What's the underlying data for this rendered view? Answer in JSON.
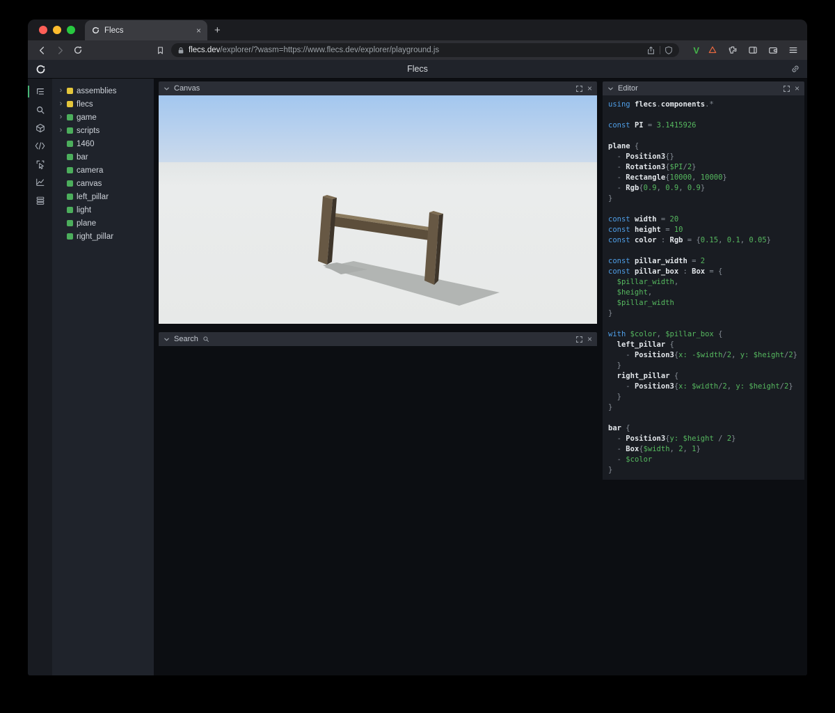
{
  "glyphs": {
    "close": "×",
    "plus": "+",
    "chevron": "›"
  },
  "browser": {
    "tab_title": "Flecs",
    "url_domain": "flecs.dev",
    "url_path": "/explorer/?wasm=https://www.flecs.dev/explorer/playground.js",
    "ext_v_label": "V",
    "traffic": {
      "red": "#ff5f57",
      "yellow": "#febc2e",
      "green": "#28c840"
    }
  },
  "app": {
    "title": "Flecs"
  },
  "tree": {
    "type_colors": {
      "module": "#e4c63b",
      "entity": "#4cae5c"
    },
    "items": [
      {
        "label": "assemblies",
        "type": "module",
        "expandable": true
      },
      {
        "label": "flecs",
        "type": "module",
        "expandable": true
      },
      {
        "label": "game",
        "type": "entity",
        "expandable": true
      },
      {
        "label": "scripts",
        "type": "entity",
        "expandable": true
      },
      {
        "label": "1460",
        "type": "entity",
        "expandable": false
      },
      {
        "label": "bar",
        "type": "entity",
        "expandable": false
      },
      {
        "label": "camera",
        "type": "entity",
        "expandable": false
      },
      {
        "label": "canvas",
        "type": "entity",
        "expandable": false
      },
      {
        "label": "left_pillar",
        "type": "entity",
        "expandable": false
      },
      {
        "label": "light",
        "type": "entity",
        "expandable": false
      },
      {
        "label": "plane",
        "type": "entity",
        "expandable": false
      },
      {
        "label": "right_pillar",
        "type": "entity",
        "expandable": false
      }
    ]
  },
  "canvas_panel": {
    "title": "Canvas"
  },
  "search_panel": {
    "title": "Search"
  },
  "editor_panel": {
    "title": "Editor",
    "lines": [
      [
        [
          "k",
          "using"
        ],
        [
          "t",
          " "
        ],
        [
          "i",
          "flecs"
        ],
        [
          "p",
          "."
        ],
        [
          "i",
          "components"
        ],
        [
          "p",
          ".*"
        ]
      ],
      [],
      [
        [
          "k",
          "const"
        ],
        [
          "t",
          " "
        ],
        [
          "i",
          "PI"
        ],
        [
          "p",
          " = "
        ],
        [
          "n",
          "3.1415926"
        ]
      ],
      [],
      [
        [
          "i",
          "plane"
        ],
        [
          "p",
          " {"
        ]
      ],
      [
        [
          "p",
          "  - "
        ],
        [
          "i",
          "Position3"
        ],
        [
          "p",
          "{}"
        ]
      ],
      [
        [
          "p",
          "  - "
        ],
        [
          "i",
          "Rotation3"
        ],
        [
          "p",
          "{"
        ],
        [
          "n",
          "$PI"
        ],
        [
          "p",
          "/"
        ],
        [
          "n",
          "2"
        ],
        [
          "p",
          "}"
        ]
      ],
      [
        [
          "p",
          "  - "
        ],
        [
          "i",
          "Rectangle"
        ],
        [
          "p",
          "{"
        ],
        [
          "n",
          "10000"
        ],
        [
          "p",
          ", "
        ],
        [
          "n",
          "10000"
        ],
        [
          "p",
          "}"
        ]
      ],
      [
        [
          "p",
          "  - "
        ],
        [
          "i",
          "Rgb"
        ],
        [
          "p",
          "{"
        ],
        [
          "n",
          "0.9"
        ],
        [
          "p",
          ", "
        ],
        [
          "n",
          "0.9"
        ],
        [
          "p",
          ", "
        ],
        [
          "n",
          "0.9"
        ],
        [
          "p",
          "}"
        ]
      ],
      [
        [
          "p",
          "}"
        ]
      ],
      [],
      [
        [
          "k",
          "const"
        ],
        [
          "t",
          " "
        ],
        [
          "i",
          "width"
        ],
        [
          "p",
          " = "
        ],
        [
          "n",
          "20"
        ]
      ],
      [
        [
          "k",
          "const"
        ],
        [
          "t",
          " "
        ],
        [
          "i",
          "height"
        ],
        [
          "p",
          " = "
        ],
        [
          "n",
          "10"
        ]
      ],
      [
        [
          "k",
          "const"
        ],
        [
          "t",
          " "
        ],
        [
          "i",
          "color"
        ],
        [
          "p",
          " : "
        ],
        [
          "i",
          "Rgb"
        ],
        [
          "p",
          " = {"
        ],
        [
          "n",
          "0.15"
        ],
        [
          "p",
          ", "
        ],
        [
          "n",
          "0.1"
        ],
        [
          "p",
          ", "
        ],
        [
          "n",
          "0.05"
        ],
        [
          "p",
          "}"
        ]
      ],
      [],
      [
        [
          "k",
          "const"
        ],
        [
          "t",
          " "
        ],
        [
          "i",
          "pillar_width"
        ],
        [
          "p",
          " = "
        ],
        [
          "n",
          "2"
        ]
      ],
      [
        [
          "k",
          "const"
        ],
        [
          "t",
          " "
        ],
        [
          "i",
          "pillar_box"
        ],
        [
          "p",
          " : "
        ],
        [
          "i",
          "Box"
        ],
        [
          "p",
          " = {"
        ]
      ],
      [
        [
          "n",
          "  $pillar_width"
        ],
        [
          "p",
          ","
        ]
      ],
      [
        [
          "n",
          "  $height"
        ],
        [
          "p",
          ","
        ]
      ],
      [
        [
          "n",
          "  $pillar_width"
        ]
      ],
      [
        [
          "p",
          "}"
        ]
      ],
      [],
      [
        [
          "k",
          "with"
        ],
        [
          "t",
          " "
        ],
        [
          "n",
          "$color"
        ],
        [
          "p",
          ", "
        ],
        [
          "n",
          "$pillar_box"
        ],
        [
          "p",
          " {"
        ]
      ],
      [
        [
          "t",
          "  "
        ],
        [
          "i",
          "left_pillar"
        ],
        [
          "p",
          " {"
        ]
      ],
      [
        [
          "p",
          "    - "
        ],
        [
          "i",
          "Position3"
        ],
        [
          "p",
          "{"
        ],
        [
          "n",
          "x:"
        ],
        [
          "t",
          " "
        ],
        [
          "n",
          "-$width"
        ],
        [
          "p",
          "/"
        ],
        [
          "n",
          "2"
        ],
        [
          "p",
          ", "
        ],
        [
          "n",
          "y:"
        ],
        [
          "t",
          " "
        ],
        [
          "n",
          "$height"
        ],
        [
          "p",
          "/"
        ],
        [
          "n",
          "2"
        ],
        [
          "p",
          "}"
        ]
      ],
      [
        [
          "p",
          "  }"
        ]
      ],
      [
        [
          "t",
          "  "
        ],
        [
          "i",
          "right_pillar"
        ],
        [
          "p",
          " {"
        ]
      ],
      [
        [
          "p",
          "    - "
        ],
        [
          "i",
          "Position3"
        ],
        [
          "p",
          "{"
        ],
        [
          "n",
          "x:"
        ],
        [
          "t",
          " "
        ],
        [
          "n",
          "$width"
        ],
        [
          "p",
          "/"
        ],
        [
          "n",
          "2"
        ],
        [
          "p",
          ", "
        ],
        [
          "n",
          "y:"
        ],
        [
          "t",
          " "
        ],
        [
          "n",
          "$height"
        ],
        [
          "p",
          "/"
        ],
        [
          "n",
          "2"
        ],
        [
          "p",
          "}"
        ]
      ],
      [
        [
          "p",
          "  }"
        ]
      ],
      [
        [
          "p",
          "}"
        ]
      ],
      [],
      [
        [
          "i",
          "bar"
        ],
        [
          "p",
          " {"
        ]
      ],
      [
        [
          "p",
          "  - "
        ],
        [
          "i",
          "Position3"
        ],
        [
          "p",
          "{"
        ],
        [
          "n",
          "y:"
        ],
        [
          "t",
          " "
        ],
        [
          "n",
          "$height"
        ],
        [
          "t",
          " "
        ],
        [
          "p",
          "/"
        ],
        [
          "t",
          " "
        ],
        [
          "n",
          "2"
        ],
        [
          "p",
          "}"
        ]
      ],
      [
        [
          "p",
          "  - "
        ],
        [
          "i",
          "Box"
        ],
        [
          "p",
          "{"
        ],
        [
          "n",
          "$width"
        ],
        [
          "p",
          ", "
        ],
        [
          "n",
          "2"
        ],
        [
          "p",
          ", "
        ],
        [
          "n",
          "1"
        ],
        [
          "p",
          "}"
        ]
      ],
      [
        [
          "p",
          "  - "
        ],
        [
          "n",
          "$color"
        ]
      ],
      [
        [
          "p",
          "}"
        ]
      ]
    ]
  }
}
